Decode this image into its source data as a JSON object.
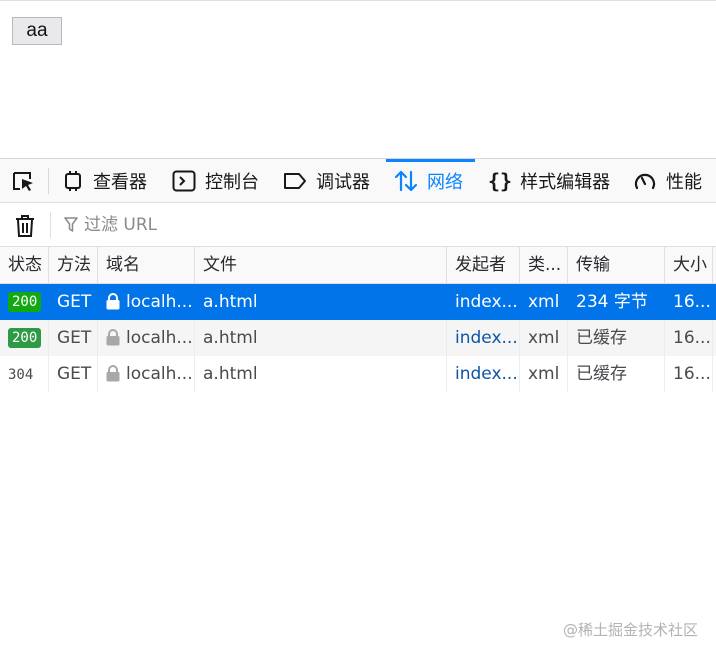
{
  "page": {
    "button_label": "aa"
  },
  "devtools": {
    "tabs": [
      {
        "icon": "inspector-icon",
        "label": "查看器"
      },
      {
        "icon": "console-icon",
        "label": "控制台"
      },
      {
        "icon": "debugger-icon",
        "label": "调试器"
      },
      {
        "icon": "network-icon",
        "label": "网络",
        "selected": true
      },
      {
        "icon": "style-editor-icon",
        "label": "样式编辑器"
      },
      {
        "icon": "performance-icon",
        "label": "性能"
      }
    ],
    "filter": {
      "placeholder": "过滤 URL"
    },
    "columns": [
      "状态",
      "方法",
      "域名",
      "文件",
      "发起者",
      "类...",
      "传输",
      "大小"
    ],
    "rows": [
      {
        "status": "200",
        "method": "GET",
        "domain": "localh...",
        "file": "a.html",
        "initiator": "index...",
        "type": "xml",
        "transferred": "234 字节",
        "size": "16...",
        "selected": true
      },
      {
        "status": "200",
        "method": "GET",
        "domain": "localh...",
        "file": "a.html",
        "initiator": "index...",
        "type": "xml",
        "transferred": "已缓存",
        "size": "16..."
      },
      {
        "status": "304",
        "method": "GET",
        "domain": "localh...",
        "file": "a.html",
        "initiator": "index...",
        "type": "xml",
        "transferred": "已缓存",
        "size": "16..."
      }
    ],
    "accent_color": "#0a84ff",
    "selected_row_color": "#0074e8"
  },
  "watermark": "@稀土掘金技术社区"
}
